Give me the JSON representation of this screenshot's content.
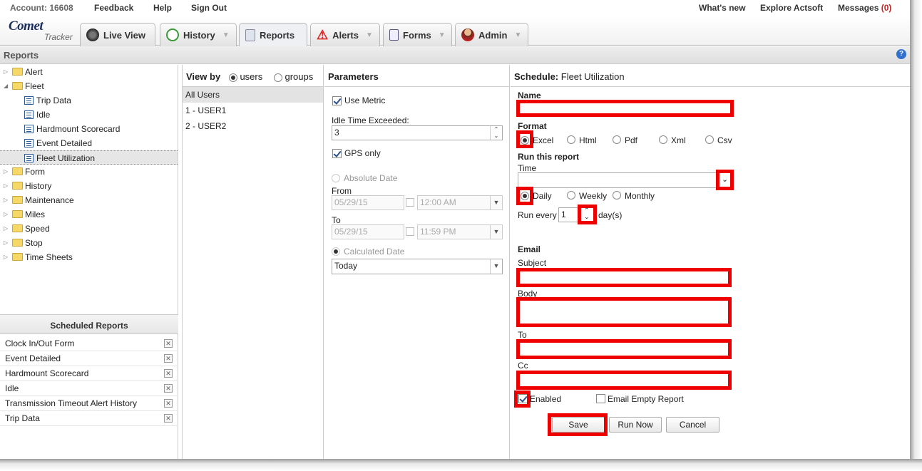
{
  "topbar": {
    "account": "Account: 16608",
    "feedback": "Feedback",
    "help": "Help",
    "signout": "Sign Out",
    "whats_new": "What's new",
    "explore": "Explore Actsoft",
    "messages": "Messages ",
    "messages_count": "(0)"
  },
  "logo": {
    "comet": "Comet",
    "tracker": "Tracker"
  },
  "tabs": [
    {
      "label": "Live View"
    },
    {
      "label": "History"
    },
    {
      "label": "Reports"
    },
    {
      "label": "Alerts"
    },
    {
      "label": "Forms"
    },
    {
      "label": "Admin"
    }
  ],
  "tab_arrow": "▼",
  "page_title": "Reports",
  "tree": {
    "alert": "Alert",
    "fleet": "Fleet",
    "trip": "Trip Data",
    "idle": "Idle",
    "hardmount": "Hardmount Scorecard",
    "event": "Event Detailed",
    "fleetutil": "Fleet Utilization",
    "form": "Form",
    "history": "History",
    "maintenance": "Maintenance",
    "miles": "Miles",
    "speed": "Speed",
    "stop": "Stop",
    "timesheets": "Time Sheets"
  },
  "scheduled": {
    "title": "Scheduled Reports",
    "items": [
      "Clock In/Out Form",
      "Event Detailed",
      "Hardmount Scorecard",
      "Idle",
      "Transmission Timeout Alert History",
      "Trip Data"
    ]
  },
  "viewby": {
    "label": "View by",
    "users": "users",
    "groups": "groups",
    "items": [
      "All Users",
      "1 - USER1",
      "2 - USER2"
    ]
  },
  "params": {
    "title": "Parameters",
    "metric": "Use Metric",
    "idle_label": "Idle Time Exceeded:",
    "idle_value": "3",
    "gps": "GPS only",
    "absolute": "Absolute Date",
    "from": "From",
    "from_date": "05/29/15",
    "from_time": "12:00 AM",
    "to": "To",
    "to_date": "05/29/15",
    "to_time": "11:59 PM",
    "calculated": "Calculated Date",
    "calc_value": "Today"
  },
  "schedule": {
    "title": "Schedule:",
    "report": "Fleet Utilization",
    "name": "Name",
    "format": "Format",
    "formats": [
      "Excel",
      "Html",
      "Pdf",
      "Xml",
      "Csv"
    ],
    "run": "Run this report",
    "time": "Time",
    "freq": [
      "Daily",
      "Weekly",
      "Monthly"
    ],
    "run_every": "Run every",
    "every_value": "1",
    "days": "day(s)",
    "email": "Email",
    "subject": "Subject",
    "body": "Body",
    "to": "To",
    "cc": "Cc",
    "enabled": "Enabled",
    "empty": "Email Empty Report",
    "save": "Save",
    "runnow": "Run Now",
    "cancel": "Cancel"
  },
  "colors": {
    "highlight": "#ee0000",
    "accent": "#2f6fd0"
  }
}
